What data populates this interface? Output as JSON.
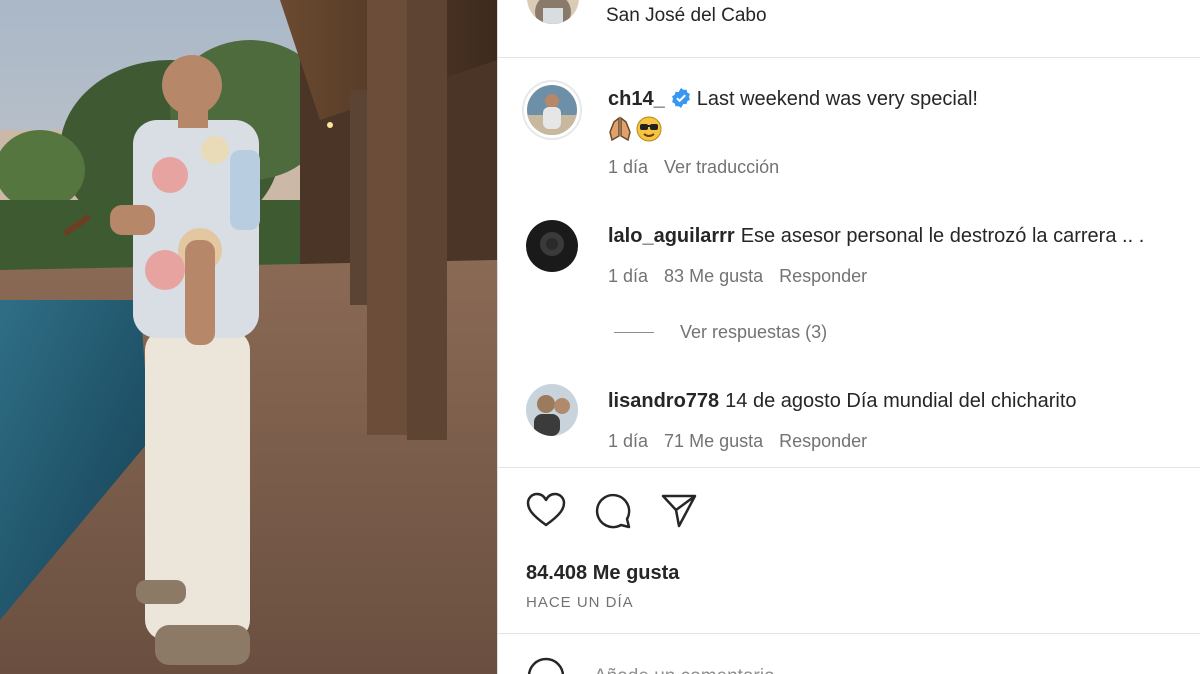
{
  "post": {
    "location": "San José del Cabo",
    "caption": {
      "username": "ch14_",
      "text": "Last weekend was very special!",
      "emojis": [
        "pray-icon",
        "sunglasses-face-icon"
      ],
      "age": "1 día",
      "translate_label": "Ver traducción"
    },
    "comments": [
      {
        "username": "lalo_aguilarrr",
        "text": "Ese asesor personal le destrozó la carrera .. .",
        "age": "1 día",
        "likes": "83 Me gusta",
        "reply_label": "Responder",
        "view_replies": "Ver respuestas (3)"
      },
      {
        "username": "lisandro778",
        "text": "14 de agosto Día mundial del chicharito",
        "age": "1 día",
        "likes": "71 Me gusta",
        "reply_label": "Responder"
      }
    ],
    "like_count": "84.408 Me gusta",
    "posted_ago": "HACE UN DÍA",
    "add_comment_placeholder": "Añade un comentario..."
  },
  "colors": {
    "verified": "#3897f0",
    "secondary_text": "#737373",
    "primary_text": "#262626"
  }
}
